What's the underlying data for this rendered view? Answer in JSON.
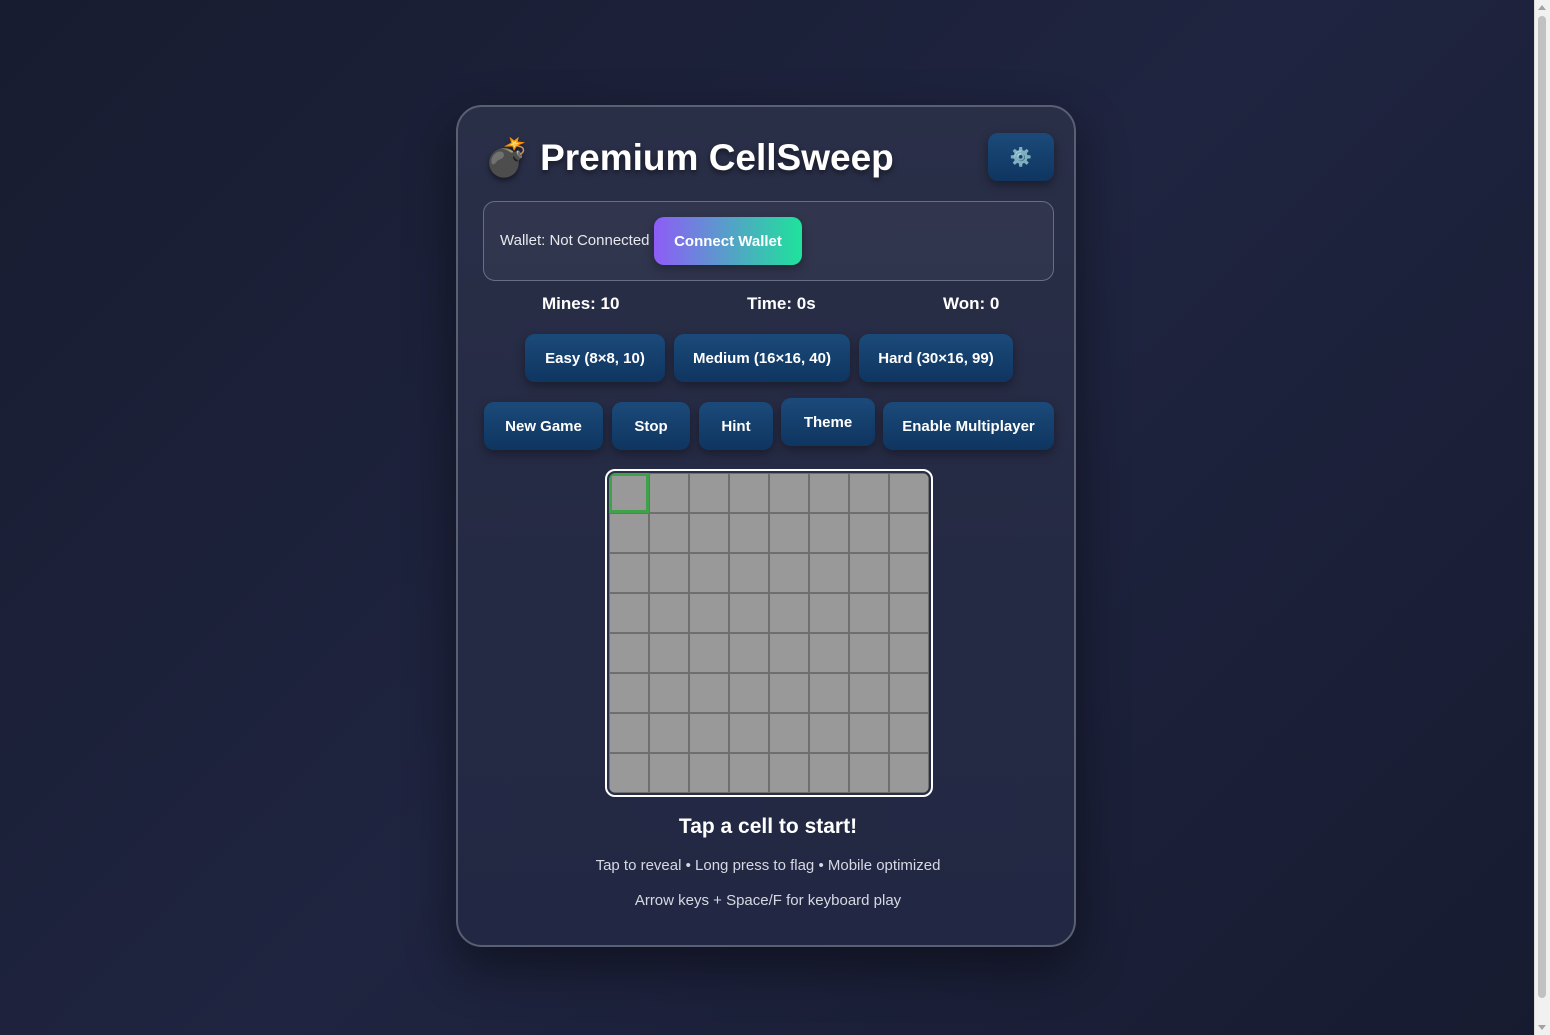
{
  "app": {
    "title": "Premium CellSweep",
    "title_icon": "💣",
    "settings_icon": "⚙️"
  },
  "wallet": {
    "status": "Wallet: Not Connected",
    "connect_label": "Connect Wallet"
  },
  "stats": {
    "mines": "Mines: 10",
    "time": "Time: 0s",
    "won": "Won: 0"
  },
  "difficulty": {
    "easy": "Easy (8×8, 10)",
    "medium": "Medium (16×16, 40)",
    "hard": "Hard (30×16, 99)"
  },
  "controls": {
    "new_game": "New Game",
    "stop": "Stop",
    "hint": "Hint",
    "theme": "Theme",
    "multiplayer": "Enable Multiplayer"
  },
  "board": {
    "rows": 8,
    "cols": 8,
    "focused_row": 0,
    "focused_col": 0
  },
  "status_message": "Tap a cell to start!",
  "help": {
    "line1": "Tap to reveal • Long press to flag • Mobile optimized",
    "line2": "Arrow keys + Space/F for keyboard play"
  }
}
